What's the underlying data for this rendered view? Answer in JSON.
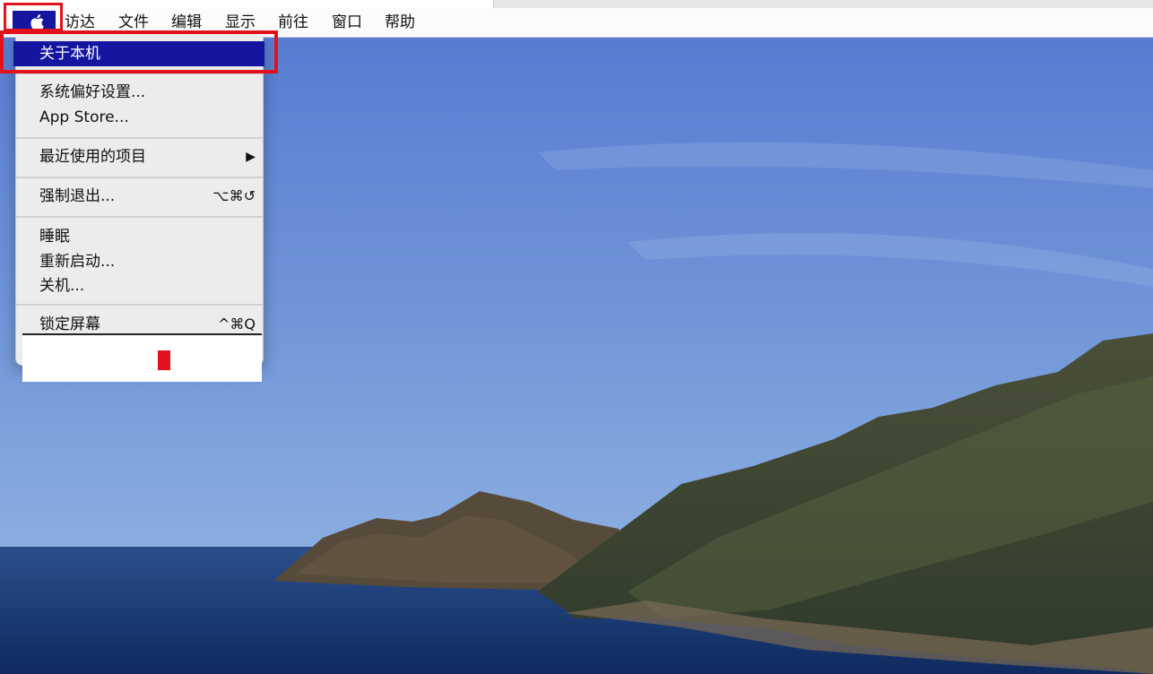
{
  "menubar": {
    "apple_icon": "apple-logo-icon",
    "items": [
      {
        "label": "访达"
      },
      {
        "label": "文件"
      },
      {
        "label": "编辑"
      },
      {
        "label": "显示"
      },
      {
        "label": "前往"
      },
      {
        "label": "窗口"
      },
      {
        "label": "帮助"
      }
    ]
  },
  "apple_menu": {
    "about": "关于本机",
    "system_prefs": "系统偏好设置...",
    "app_store": "App Store...",
    "recent_items": "最近使用的项目",
    "recent_items_arrow": "▶",
    "force_quit": "强制退出...",
    "force_quit_shortcut": "⌥⌘↺",
    "sleep": "睡眠",
    "restart": "重新启动...",
    "shutdown": "关机...",
    "lock_screen": "锁定屏幕",
    "lock_screen_shortcut": "^⌘Q"
  },
  "colors": {
    "highlight": "#1515a0",
    "annotation_red": "#e1121b",
    "menu_bg": "#ececec"
  }
}
